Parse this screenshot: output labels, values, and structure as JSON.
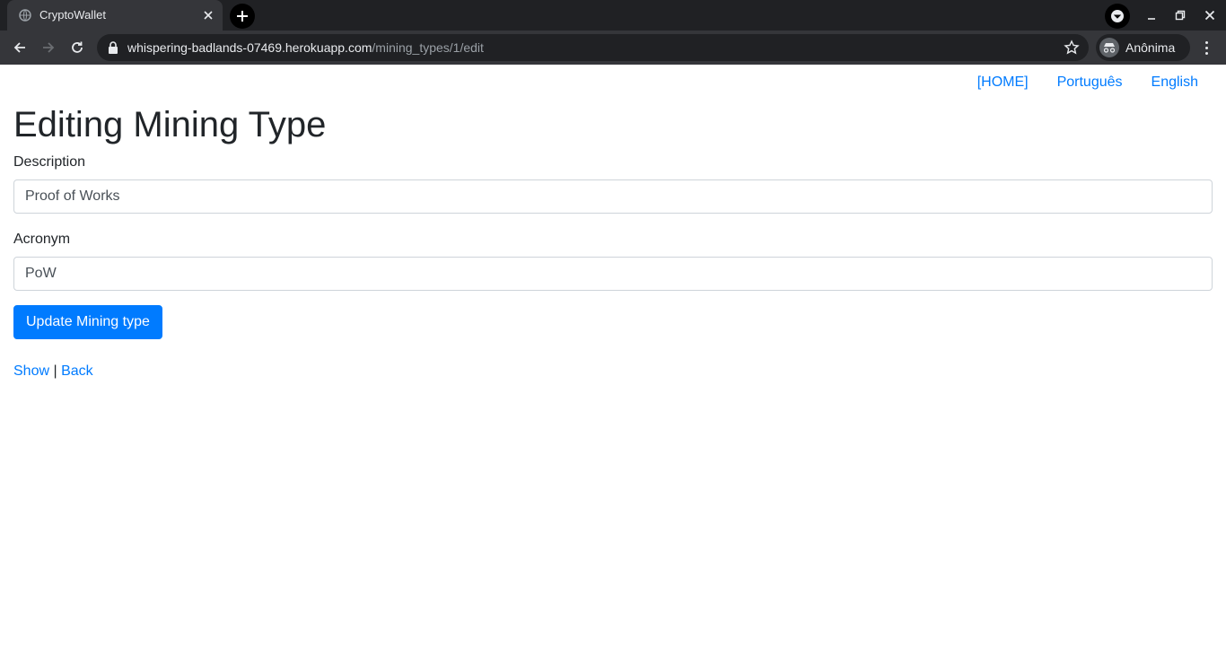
{
  "browser": {
    "tab_title": "CryptoWallet",
    "url_host": "whispering-badlands-07469.herokuapp.com",
    "url_path": "/mining_types/1/edit",
    "profile_label": "Anônima"
  },
  "nav": {
    "home": "[HOME]",
    "portuguese": "Português",
    "english": "English"
  },
  "page": {
    "title": "Editing Mining Type"
  },
  "form": {
    "description_label": "Description",
    "description_value": "Proof of Works",
    "acronym_label": "Acronym",
    "acronym_value": "PoW",
    "submit_label": "Update Mining type"
  },
  "footer_links": {
    "show": "Show",
    "separator": "|",
    "back": "Back"
  },
  "colors": {
    "link": "#007bff",
    "button": "#007bff",
    "chrome_dark": "#202124",
    "chrome_toolbar": "#35363a"
  }
}
